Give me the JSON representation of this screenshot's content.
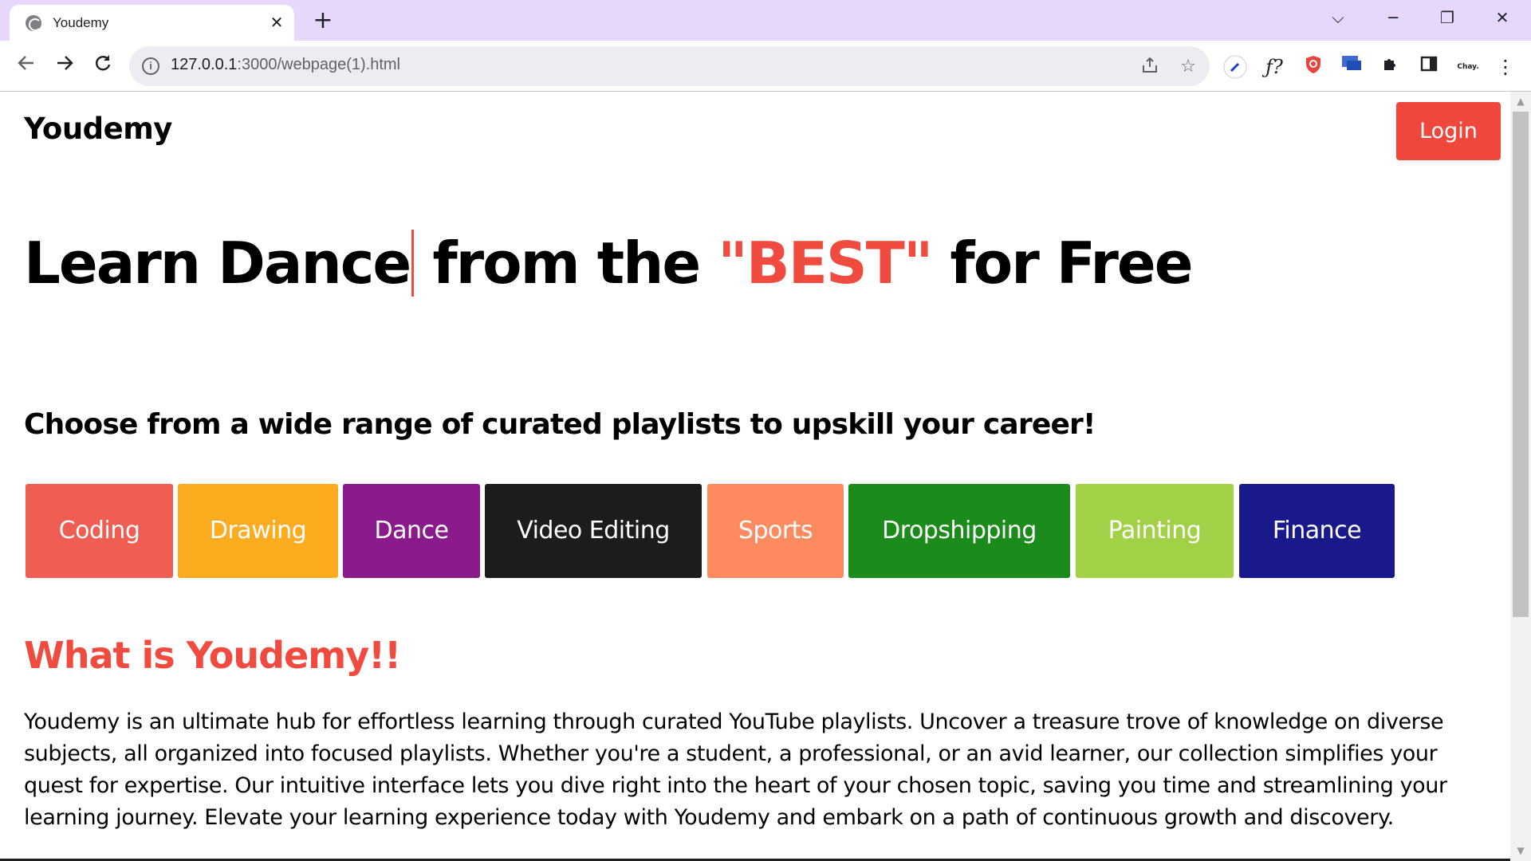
{
  "browser": {
    "tab_title": "Youdemy",
    "tab_close": "✕",
    "new_tab": "+",
    "url_host": "127.0.0.1",
    "url_rest": ":3000/webpage(1).html",
    "extension_label": "Chay.",
    "window_controls": {
      "dropdown": "⌵",
      "minimize": "─",
      "restore": "❐",
      "close": "✕"
    },
    "icons": [
      "back-arrow-icon",
      "forward-arrow-icon",
      "reload-icon",
      "info-icon",
      "share-icon",
      "star-icon",
      "extensions-puzzle-icon",
      "side-panel-icon",
      "menu-dots-icon"
    ]
  },
  "header": {
    "logo": "Youdemy",
    "login_label": "Login"
  },
  "hero": {
    "prefix": "Learn ",
    "typed_word": "Dance",
    "middle": " from the ",
    "highlight": "\"BEST\"",
    "suffix": " for Free"
  },
  "subheading": "Choose from a wide range of curated playlists to upskill your career!",
  "categories": [
    {
      "label": "Coding",
      "color": "#f05d53"
    },
    {
      "label": "Drawing",
      "color": "#fdab1f"
    },
    {
      "label": "Dance",
      "color": "#8b1a8c"
    },
    {
      "label": "Video Editing",
      "color": "#1c1c1c"
    },
    {
      "label": "Sports",
      "color": "#fd8b5f"
    },
    {
      "label": "Dropshipping",
      "color": "#1b8c1b"
    },
    {
      "label": "Painting",
      "color": "#a2d148"
    },
    {
      "label": "Finance",
      "color": "#1a198c"
    }
  ],
  "about": {
    "title": "What is Youdemy!!",
    "body": "Youdemy is an ultimate hub for effortless learning through curated YouTube playlists. Uncover a treasure trove of knowledge on diverse subjects, all organized into focused playlists. Whether you're a student, a professional, or an avid learner, our collection simplifies your quest for expertise. Our intuitive interface lets you dive right into the heart of your chosen topic, saving you time and streamlining your learning journey. Elevate your learning experience today with Youdemy and embark on a path of continuous growth and discovery."
  }
}
